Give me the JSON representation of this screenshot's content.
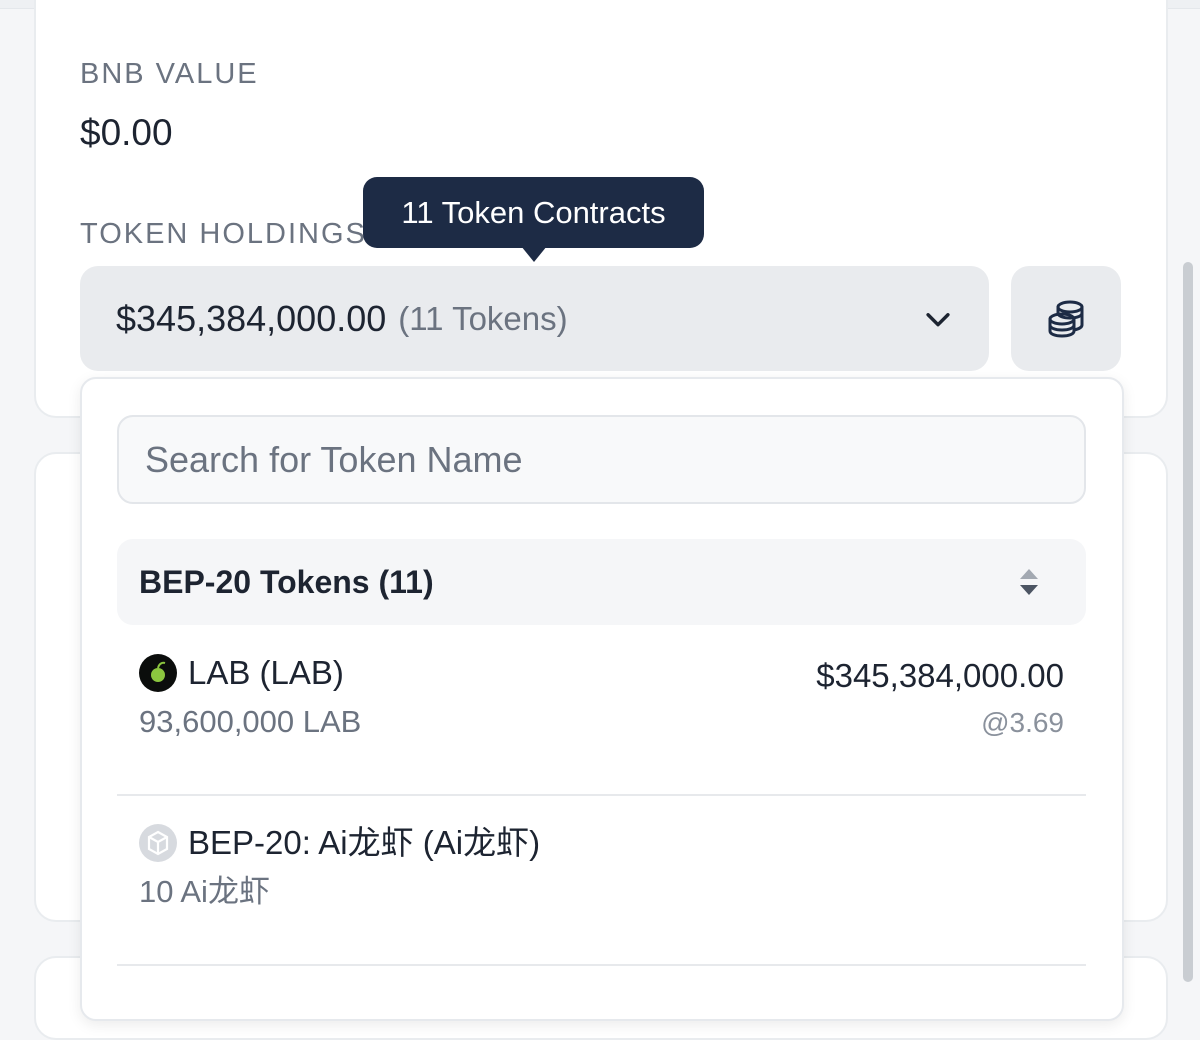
{
  "overview": {
    "bnb_label": "BNB VALUE",
    "bnb_value": "$0.00",
    "holdings_label": "TOKEN HOLDINGS",
    "holdings_amount": "$345,384,000.00",
    "holdings_count": "(11 Tokens)"
  },
  "tooltip": {
    "text": "11 Token Contracts"
  },
  "dropdown": {
    "search_placeholder": "Search for Token Name",
    "group_title": "BEP-20 Tokens (11)",
    "tokens": [
      {
        "name": "LAB (LAB)",
        "amount": "93,600,000 LAB",
        "value": "$345,384,000.00",
        "price": "@3.69",
        "icon": "lab-token-logo"
      },
      {
        "name": "BEP-20: Ai龙虾 (Ai龙虾)",
        "amount": "10 Ai龙虾",
        "value": "",
        "price": "",
        "icon": "generic-token-icon"
      }
    ]
  },
  "colors": {
    "tooltip_bg": "#1d2b45",
    "control_bg": "#e9ebee",
    "muted_text": "#6b7380"
  }
}
